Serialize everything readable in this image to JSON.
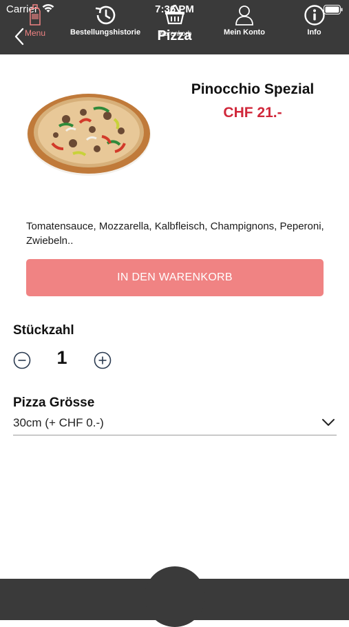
{
  "status_bar": {
    "carrier": "Carrier",
    "time": "7:36 PM"
  },
  "nav": {
    "title": "Pizza",
    "back_icon": "chevron-left-icon"
  },
  "product": {
    "name": "Pinocchio Spezial",
    "price": "CHF 21.-",
    "description": "Tomatensauce, Mozzarella, Kalbfleisch, Champignons, Peperoni, Zwiebeln..",
    "image_icon": "pizza-image"
  },
  "actions": {
    "add_to_cart": "IN DEN WARENKORB"
  },
  "quantity": {
    "label": "Stückzahl",
    "value": "1"
  },
  "size": {
    "label": "Pizza Grösse",
    "selected": "30cm (+ CHF 0.-)"
  },
  "tabs": [
    {
      "label": "Menu",
      "icon": "menu-bottle-icon",
      "active": true
    },
    {
      "label": "Bestellungshistorie",
      "icon": "history-icon",
      "active": false
    },
    {
      "label": "Warenkorb",
      "icon": "basket-icon",
      "active": false
    },
    {
      "label": "Mein Konto",
      "icon": "user-icon",
      "active": false
    },
    {
      "label": "Info",
      "icon": "info-icon",
      "active": false
    }
  ],
  "colors": {
    "header": "#3a3a3a",
    "accent": "#f08383",
    "price": "#d0283b"
  }
}
